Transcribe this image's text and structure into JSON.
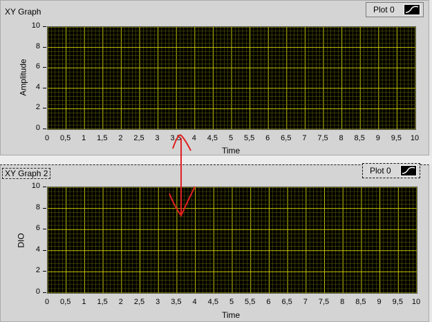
{
  "top_graph": {
    "title": "XY Graph",
    "legend_label": "Plot 0",
    "x_axis_label": "Time",
    "y_axis_label": "Amplitude",
    "x_ticks": [
      "0",
      "0,5",
      "1",
      "1,5",
      "2",
      "2,5",
      "3",
      "3,5",
      "4",
      "4,5",
      "5",
      "5,5",
      "6",
      "6,5",
      "7",
      "7,5",
      "8",
      "8,5",
      "9",
      "9,5",
      "10"
    ],
    "y_ticks": [
      "10",
      "8",
      "6",
      "4",
      "2",
      "0"
    ]
  },
  "bottom_graph": {
    "title": "XY Graph 2",
    "legend_label": "Plot 0",
    "x_axis_label": "Time",
    "y_axis_label": "DIO",
    "x_ticks": [
      "0",
      "0,5",
      "1",
      "1,5",
      "2",
      "2,5",
      "3",
      "3,5",
      "4",
      "4,5",
      "5",
      "5,5",
      "6",
      "6,5",
      "7",
      "7,5",
      "8",
      "8,5",
      "9",
      "9,5",
      "10"
    ],
    "y_ticks": [
      "10",
      "8",
      "6",
      "4",
      "2",
      "0"
    ]
  },
  "colors": {
    "plot_background": "#000000",
    "grid_major": "#c8c800",
    "grid_minor": "#5a5a00",
    "annotation": "#e02020"
  },
  "icons": {
    "legend_swatch": "plot-line-icon",
    "annotation": "double-headed-arrow-icon"
  }
}
